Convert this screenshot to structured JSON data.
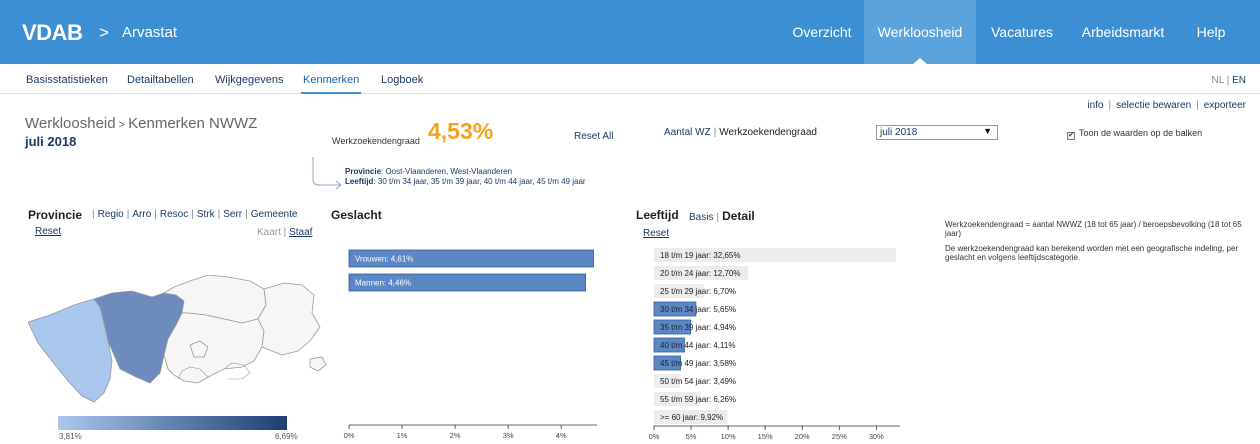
{
  "header": {
    "logo": "VDAB",
    "separator": ">",
    "app_name": "Arvastat",
    "nav": [
      {
        "label": "Overzicht",
        "active": false
      },
      {
        "label": "Werkloosheid",
        "active": true
      },
      {
        "label": "Vacatures",
        "active": false
      },
      {
        "label": "Arbeidsmarkt",
        "active": false
      },
      {
        "label": "Help",
        "active": false
      }
    ]
  },
  "subnav": {
    "items": [
      {
        "label": "Basisstatistieken",
        "active": false
      },
      {
        "label": "Detailtabellen",
        "active": false
      },
      {
        "label": "Wijkgegevens",
        "active": false
      },
      {
        "label": "Kenmerken",
        "active": true
      },
      {
        "label": "Logboek",
        "active": false
      }
    ],
    "lang_nl": "NL",
    "lang_sep": "|",
    "lang_en": "EN"
  },
  "toplinks": {
    "info": "info",
    "save": "selectie bewaren",
    "export": "exporteer",
    "sep": "|"
  },
  "page": {
    "breadcrumb_1": "Werkloosheid",
    "breadcrumb_sep": " > ",
    "breadcrumb_2": "Kenmerken NWWZ",
    "period": "juli 2018"
  },
  "summary": {
    "label": "Werkzoekendengraad",
    "value": "4,53%",
    "reset_all": "Reset All",
    "aantal_wz": "Aantal WZ",
    "sep": "|",
    "wzg": "Werkzoekendengraad",
    "dropdown_value": "juli 2018",
    "dropdown_arrow": "▼",
    "toon_label": "Toon de waarden op de balken",
    "toon_checked": true
  },
  "filter": {
    "provincie_label": "Provincie",
    "provincie_value": ": Oost-Vlaanderen, West-Vlaanderen",
    "leeftijd_label": "Leeftijd",
    "leeftijd_value": ": 30 t/m 34 jaar, 35 t/m 39 jaar, 40 t/m 44 jaar, 45 t/m 49 jaar"
  },
  "provincie": {
    "title": "Provincie",
    "links": [
      "Regio",
      "Arro",
      "Resoc",
      "Strk",
      "Serr",
      "Gemeente"
    ],
    "reset": "Reset",
    "kaart": "Kaart",
    "staaf": "Staaf",
    "legend_min": "3,81%",
    "legend_max": "6,69%",
    "colors": {
      "west": "#a9c6ec",
      "oost": "#6d8cbd",
      "other": "#f6f6f6",
      "stroke": "#999999"
    }
  },
  "geslacht": {
    "title": "Geslacht"
  },
  "leeftijd": {
    "title": "Leeftijd",
    "basis": "Basis",
    "sep": "|",
    "detail": "Detail",
    "reset": "Reset"
  },
  "description": {
    "p1": "Werkzoekendengraad = aantal NWWZ (18 tot 65 jaar) / beroepsbevolking (18 tot 65 jaar)",
    "p2": "De werkzoekendengraad kan berekend worden met een geografische indeling, per geslacht en volgens leeftijdscategorie."
  },
  "chart_data": [
    {
      "type": "bar",
      "orientation": "horizontal",
      "categories": [
        "Vrouwen",
        "Mannen"
      ],
      "labels": [
        "Vrouwen: 4,61%",
        "Mannen: 4,46%"
      ],
      "values": [
        4.61,
        4.46
      ],
      "selected": [
        true,
        true
      ],
      "xlim": [
        0,
        4.6
      ],
      "ticks": [
        0,
        1,
        2,
        3,
        4
      ],
      "tick_labels": [
        "0%",
        "1%",
        "2%",
        "3%",
        "4%"
      ],
      "colors": {
        "selected": "#5b87c5",
        "unselected": "#e8e8e8"
      }
    },
    {
      "type": "bar",
      "orientation": "horizontal",
      "categories": [
        "18 t/m 19 jaar",
        "20 t/m 24 jaar",
        "25 t/m 29 jaar",
        "30 t/m 34 jaar",
        "35 t/m 39 jaar",
        "40 t/m 44 jaar",
        "45 t/m 49 jaar",
        "50 t/m 54 jaar",
        "55 t/m 59 jaar",
        ">= 60 jaar"
      ],
      "labels": [
        "18 t/m 19 jaar: 32,65%",
        "20 t/m 24 jaar: 12,70%",
        "25 t/m 29 jaar: 6,70%",
        "30 t/m 34 jaar: 5,65%",
        "35 t/m 39 jaar: 4,94%",
        "40 t/m 44 jaar: 4,11%",
        "45 t/m 49 jaar: 3,58%",
        "50 t/m 54 jaar: 3,49%",
        "55 t/m 59 jaar: 6,26%",
        ">= 60 jaar: 9,92%"
      ],
      "values": [
        32.65,
        12.7,
        6.7,
        5.65,
        4.94,
        4.11,
        3.58,
        3.49,
        6.26,
        9.92
      ],
      "selected": [
        false,
        false,
        false,
        true,
        true,
        true,
        true,
        false,
        false,
        false
      ],
      "xlim": [
        0,
        32.65
      ],
      "ticks": [
        0,
        5,
        10,
        15,
        20,
        25,
        30
      ],
      "tick_labels": [
        "0%",
        "5%",
        "10%",
        "15%",
        "20%",
        "25%",
        "30%"
      ],
      "colors": {
        "selected": "#5b87c5",
        "unselected": "#ececec"
      }
    }
  ]
}
